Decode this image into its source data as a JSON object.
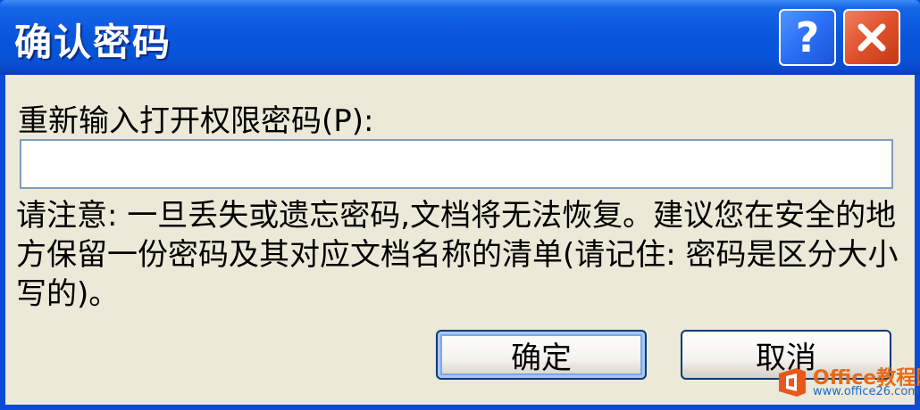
{
  "window": {
    "title": "确认密码",
    "help_label": "?",
    "close_icon": "close-x-icon"
  },
  "form": {
    "prompt_label": "重新输入打开权限密码(P):",
    "password_value": "",
    "notice_text": "请注意: 一旦丢失或遗忘密码,文档将无法恢复。建议您在安全的地方保留一份密码及其对应文档名称的清单(请记住: 密码是区分大小写的)。"
  },
  "buttons": {
    "ok_label": "确定",
    "cancel_label": "取消"
  },
  "watermark": {
    "brand": "Office教程网",
    "url": "www.office26.com",
    "icon": "office-logo-icon"
  },
  "colors": {
    "titlebar": "#0a57dd",
    "close": "#e0512d",
    "help": "#2a6ef5",
    "dialog_bg": "#ece9d8",
    "default_button_border": "#003c74"
  }
}
